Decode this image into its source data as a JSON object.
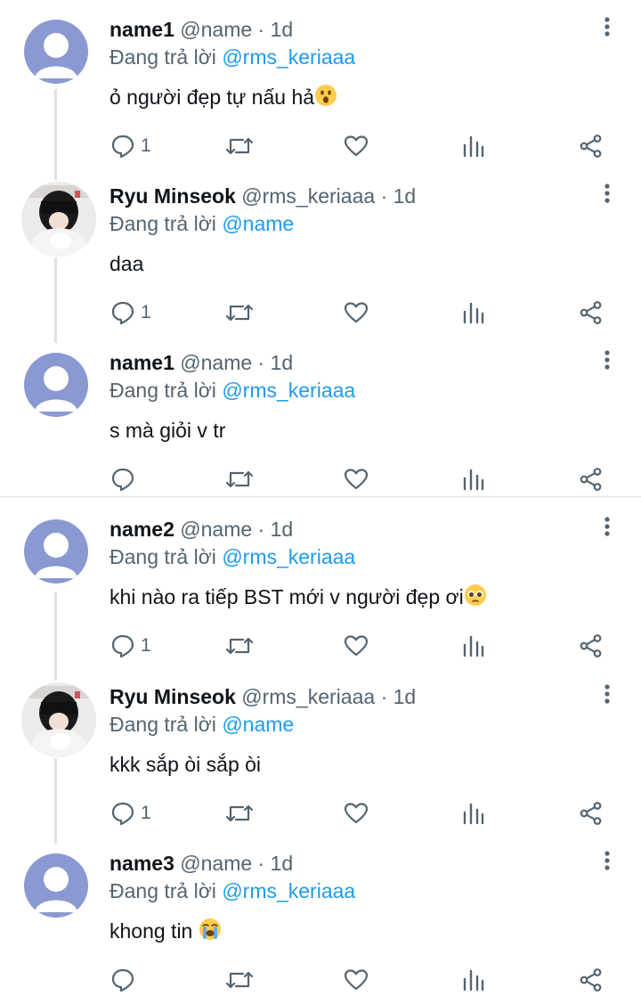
{
  "replies": [
    {
      "name": "name1",
      "handle": "@name",
      "sep": "·",
      "time": "1d",
      "reply_prefix": "Đang trả lời",
      "reply_to": "@rms_keriaaa",
      "text": "ỏ người đẹp tự nấu hả",
      "emoji": "astonished-emoji",
      "reply_count": "1",
      "avatar": "default-avatar"
    },
    {
      "name": "Ryu Minseok",
      "handle": "@rms_keriaaa",
      "sep": "·",
      "time": "1d",
      "reply_prefix": "Đang trả lời",
      "reply_to": "@name",
      "text": "daa",
      "emoji": "",
      "reply_count": "1",
      "avatar": "profile-photo"
    },
    {
      "name": "name1",
      "handle": "@name",
      "sep": "·",
      "time": "1d",
      "reply_prefix": "Đang trả lời",
      "reply_to": "@rms_keriaaa",
      "text": "s mà giỏi v tr",
      "emoji": "",
      "reply_count": "",
      "avatar": "default-avatar"
    },
    {
      "name": "name2",
      "handle": "@name",
      "sep": "·",
      "time": "1d",
      "reply_prefix": "Đang trả lời",
      "reply_to": "@rms_keriaaa",
      "text": "khi nào ra tiếp BST mới v người đẹp ơi",
      "emoji": "pleading-face-emoji",
      "reply_count": "1",
      "avatar": "default-avatar"
    },
    {
      "name": "Ryu Minseok",
      "handle": "@rms_keriaaa",
      "sep": "·",
      "time": "1d",
      "reply_prefix": "Đang trả lời",
      "reply_to": "@name",
      "text": "kkk sắp òi sắp òi",
      "emoji": "",
      "reply_count": "1",
      "avatar": "profile-photo"
    },
    {
      "name": "name3",
      "handle": "@name",
      "sep": "·",
      "time": "1d",
      "reply_prefix": "Đang trả lời",
      "reply_to": "@rms_keriaaa",
      "text": "khong tin",
      "emoji": "loudly-crying-emoji",
      "reply_count": "",
      "avatar": "default-avatar"
    }
  ],
  "colors": {
    "link": "#1d9bf0",
    "secondary_text": "#536471",
    "primary_text": "#0f1419",
    "default_avatar": "#8a99d1",
    "thread_line": "#dfe3e6"
  }
}
